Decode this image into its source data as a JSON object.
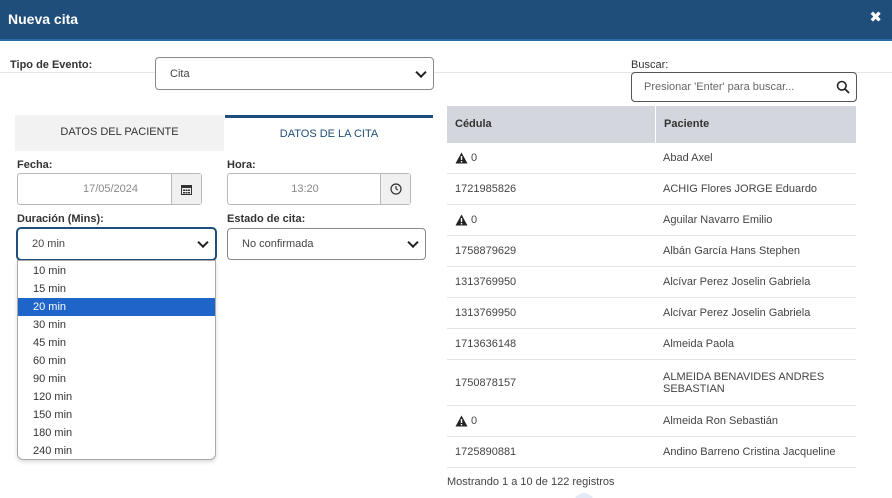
{
  "window": {
    "title": "Nueva cita",
    "close_icon": "close-icon"
  },
  "event_type": {
    "label": "Tipo de Evento:",
    "value": "Cita"
  },
  "search": {
    "label": "Buscar:",
    "placeholder": "Presionar 'Enter' para buscar..."
  },
  "tabs": [
    {
      "label": "DATOS DEL PACIENTE",
      "active": false
    },
    {
      "label": "DATOS DE LA CITA",
      "active": true
    }
  ],
  "form": {
    "fecha_label": "Fecha:",
    "fecha_value": "17/05/2024",
    "hora_label": "Hora:",
    "hora_value": "13:20",
    "duracion_label": "Duración (Mins):",
    "duracion_value": "20 min",
    "estado_label": "Estado de cita:",
    "estado_value": "No confirmada"
  },
  "duration_options": [
    "10 min",
    "15 min",
    "20 min",
    "30 min",
    "45 min",
    "60 min",
    "90 min",
    "120 min",
    "150 min",
    "180 min",
    "240 min"
  ],
  "duration_selected_index": 2,
  "table": {
    "headers": [
      "Cédula",
      "Paciente"
    ],
    "rows": [
      {
        "cedula": "0",
        "paciente": "Abad Axel",
        "warning": true
      },
      {
        "cedula": "1721985826",
        "paciente": "ACHIG Flores JORGE Eduardo",
        "warning": false
      },
      {
        "cedula": "0",
        "paciente": "Aguilar Navarro Emilio",
        "warning": true
      },
      {
        "cedula": "1758879629",
        "paciente": "Albán García Hans Stephen",
        "warning": false
      },
      {
        "cedula": "1313769950",
        "paciente": "Alcívar Perez Joselin Gabriela",
        "warning": false
      },
      {
        "cedula": "1313769950",
        "paciente": "Alcívar Perez Joselin Gabriela",
        "warning": false
      },
      {
        "cedula": "1713636148",
        "paciente": "Almeida Paola",
        "warning": false
      },
      {
        "cedula": "1750878157",
        "paciente": "ALMEIDA BENAVIDES ANDRES SEBASTIAN",
        "warning": false
      },
      {
        "cedula": "0",
        "paciente": "Almeida Ron Sebastián",
        "warning": true
      },
      {
        "cedula": "1725890881",
        "paciente": "Andino Barreno Cristina Jacqueline",
        "warning": false
      }
    ],
    "footer": "Mostrando 1 a 10 de 122 registros"
  },
  "colors": {
    "header": "#1f4e7a",
    "selected_option": "#1f64c8",
    "table_header": "#d3d6dc"
  }
}
